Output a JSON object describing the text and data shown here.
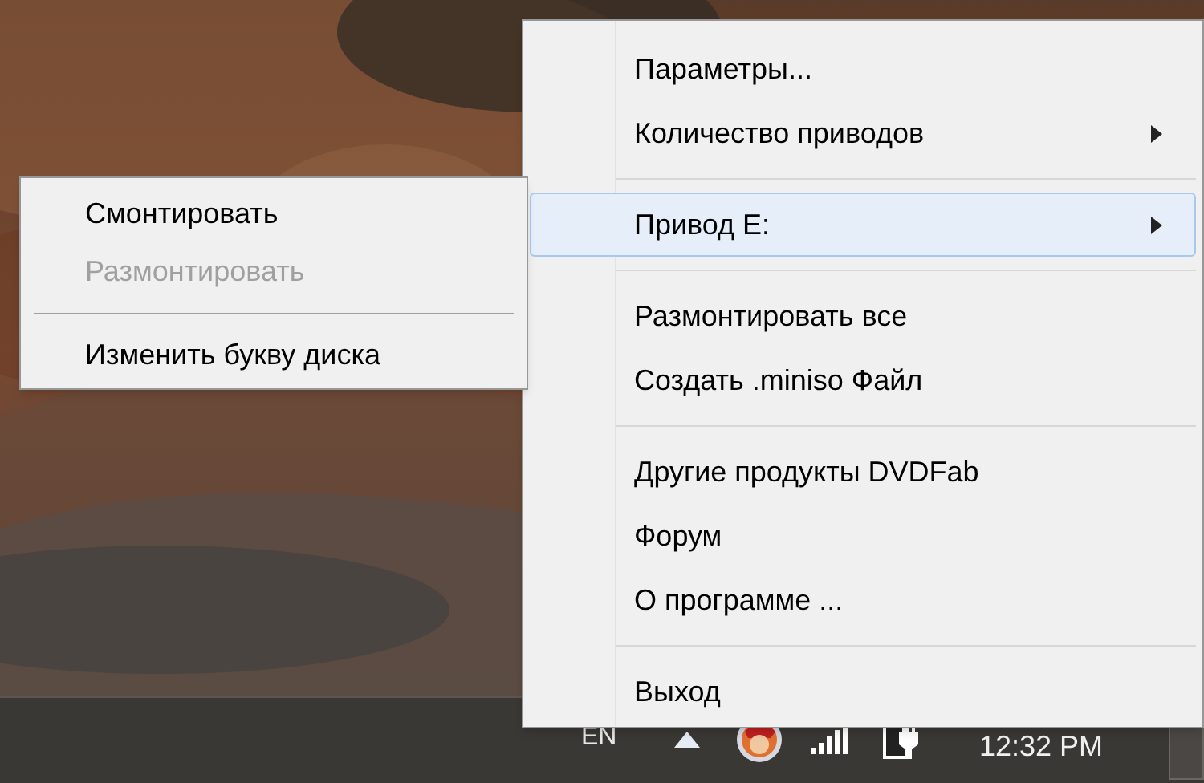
{
  "main_menu": {
    "items": [
      {
        "kind": "item",
        "label": "Параметры...",
        "submenu": false,
        "selected": false,
        "disabled": false
      },
      {
        "kind": "item",
        "label": "Количество приводов",
        "submenu": true,
        "selected": false,
        "disabled": false
      },
      {
        "kind": "separator"
      },
      {
        "kind": "item",
        "label": "Привод E:",
        "submenu": true,
        "selected": true,
        "disabled": false
      },
      {
        "kind": "separator"
      },
      {
        "kind": "item",
        "label": "Размонтировать все",
        "submenu": false,
        "selected": false,
        "disabled": false
      },
      {
        "kind": "item",
        "label": "Создать .miniso Файл",
        "submenu": false,
        "selected": false,
        "disabled": false
      },
      {
        "kind": "separator"
      },
      {
        "kind": "item",
        "label": "Другие продукты DVDFab",
        "submenu": false,
        "selected": false,
        "disabled": false
      },
      {
        "kind": "item",
        "label": "Форум",
        "submenu": false,
        "selected": false,
        "disabled": false
      },
      {
        "kind": "item",
        "label": "О программе ...",
        "submenu": false,
        "selected": false,
        "disabled": false
      },
      {
        "kind": "separator"
      },
      {
        "kind": "item",
        "label": "Выход",
        "submenu": false,
        "selected": false,
        "disabled": false
      }
    ]
  },
  "submenu": {
    "items": [
      {
        "kind": "item",
        "label": "Смонтировать",
        "disabled": false
      },
      {
        "kind": "item",
        "label": "Размонтировать",
        "disabled": true
      },
      {
        "kind": "separator"
      },
      {
        "kind": "item",
        "label": "Изменить букву диска",
        "disabled": false
      }
    ]
  },
  "taskbar": {
    "language": "EN",
    "clock": "12:32 PM"
  }
}
